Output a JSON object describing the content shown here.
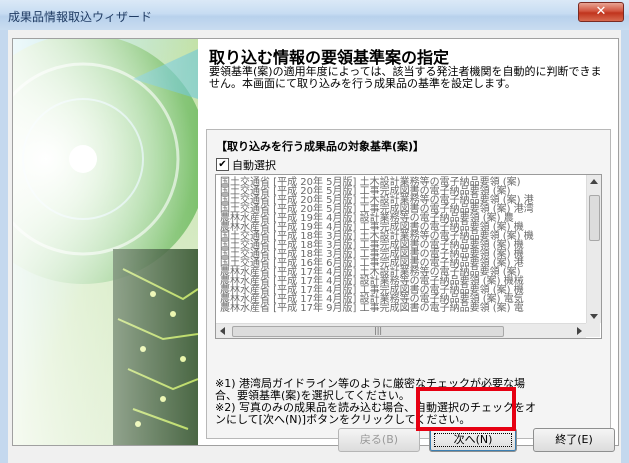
{
  "window": {
    "title": "成果品情報取込ウィザード"
  },
  "header": {
    "heading": "取り込む情報の要領基準案の指定",
    "description": "要領基準(案)の適用年度によっては、該当する発注者機関を自動的に判断できません。本画面にて取り込みを行う成果品の基準を設定します。"
  },
  "criteria": {
    "group_title": "【取り込みを行う成果品の対象基準(案)】",
    "auto_select_label": "自動選択",
    "auto_select_checked": true,
    "items": [
      "国土交通省 [平成 20年  5月版] 土木設計業務等の電子納品要領 (案)",
      "国土交通省 [平成 20年  5月版] 工事完成図書の電子納品要領 (案)",
      "国土交通省 [平成 20年  5月版] 土木設計業務等の電子納品要領 (案) 港",
      "国土交通省 [平成 20年  5月版] 工事完成図書の電子納品要領 (案) 港湾",
      "農林水産省 [平成 19年  4月版] 設計業務等の電子納品要領 (案) 農",
      "農林水産省 [平成 19年  4月版] 工事完成図書の電子納品要領 (案) 機",
      "国土交通省 [平成 18年  3月版] 土木設計業務等の電子納品要領 (案) 機",
      "国土交通省 [平成 18年  3月版] 工事完成図書の電子納品要領 (案) 機",
      "国土交通省 [平成 18年  3月版] 工事完成図書の電子納品要領 (案)   機",
      "国土交通省 [平成 16年  6月版] 工事完成図書の電子納品要領 (案) 港",
      "農林水産省 [平成 17年  4月版] 土木設計業務等の電子納品要領 (案)",
      "農林水産省 [平成 17年  4月版] 設計業務等の電子納品要領 (案) 機械",
      "農林水産省 [平成 17年  4月版] 工事完成図書の電子納品要領 (案) 機",
      "農林水産省 [平成 17年  4月版] 設計業務等の電子納品要領 (案) 電気",
      "農林水産省 [平成 17年  9月版] 工事完成図書の電子納品要領 (案) 電"
    ],
    "note1_line1": "※1) 港湾局ガイドライン等のように厳密なチェックが必要な場",
    "note1_line2": "合、要領基準(案)を選択してください。",
    "note2_line1": "※2) 写真のみの成果品を読み込む場合、自動選択のチェックをオ",
    "note2_line2": "ンにして[次へ(N)]ボタンをクリックしてください。"
  },
  "buttons": {
    "back": "戻る(B)",
    "next": "次へ(N)",
    "finish": "終了(E)"
  },
  "icons": {
    "close": "close-icon",
    "check": "check-icon",
    "scroll_up": "arrow-up-icon",
    "scroll_down": "arrow-down-icon",
    "scroll_left": "arrow-left-icon",
    "scroll_right": "arrow-right-icon"
  },
  "colors": {
    "highlight_box": "#e60012",
    "titlebar": "#c7dcf2",
    "close_button": "#c0341d"
  }
}
